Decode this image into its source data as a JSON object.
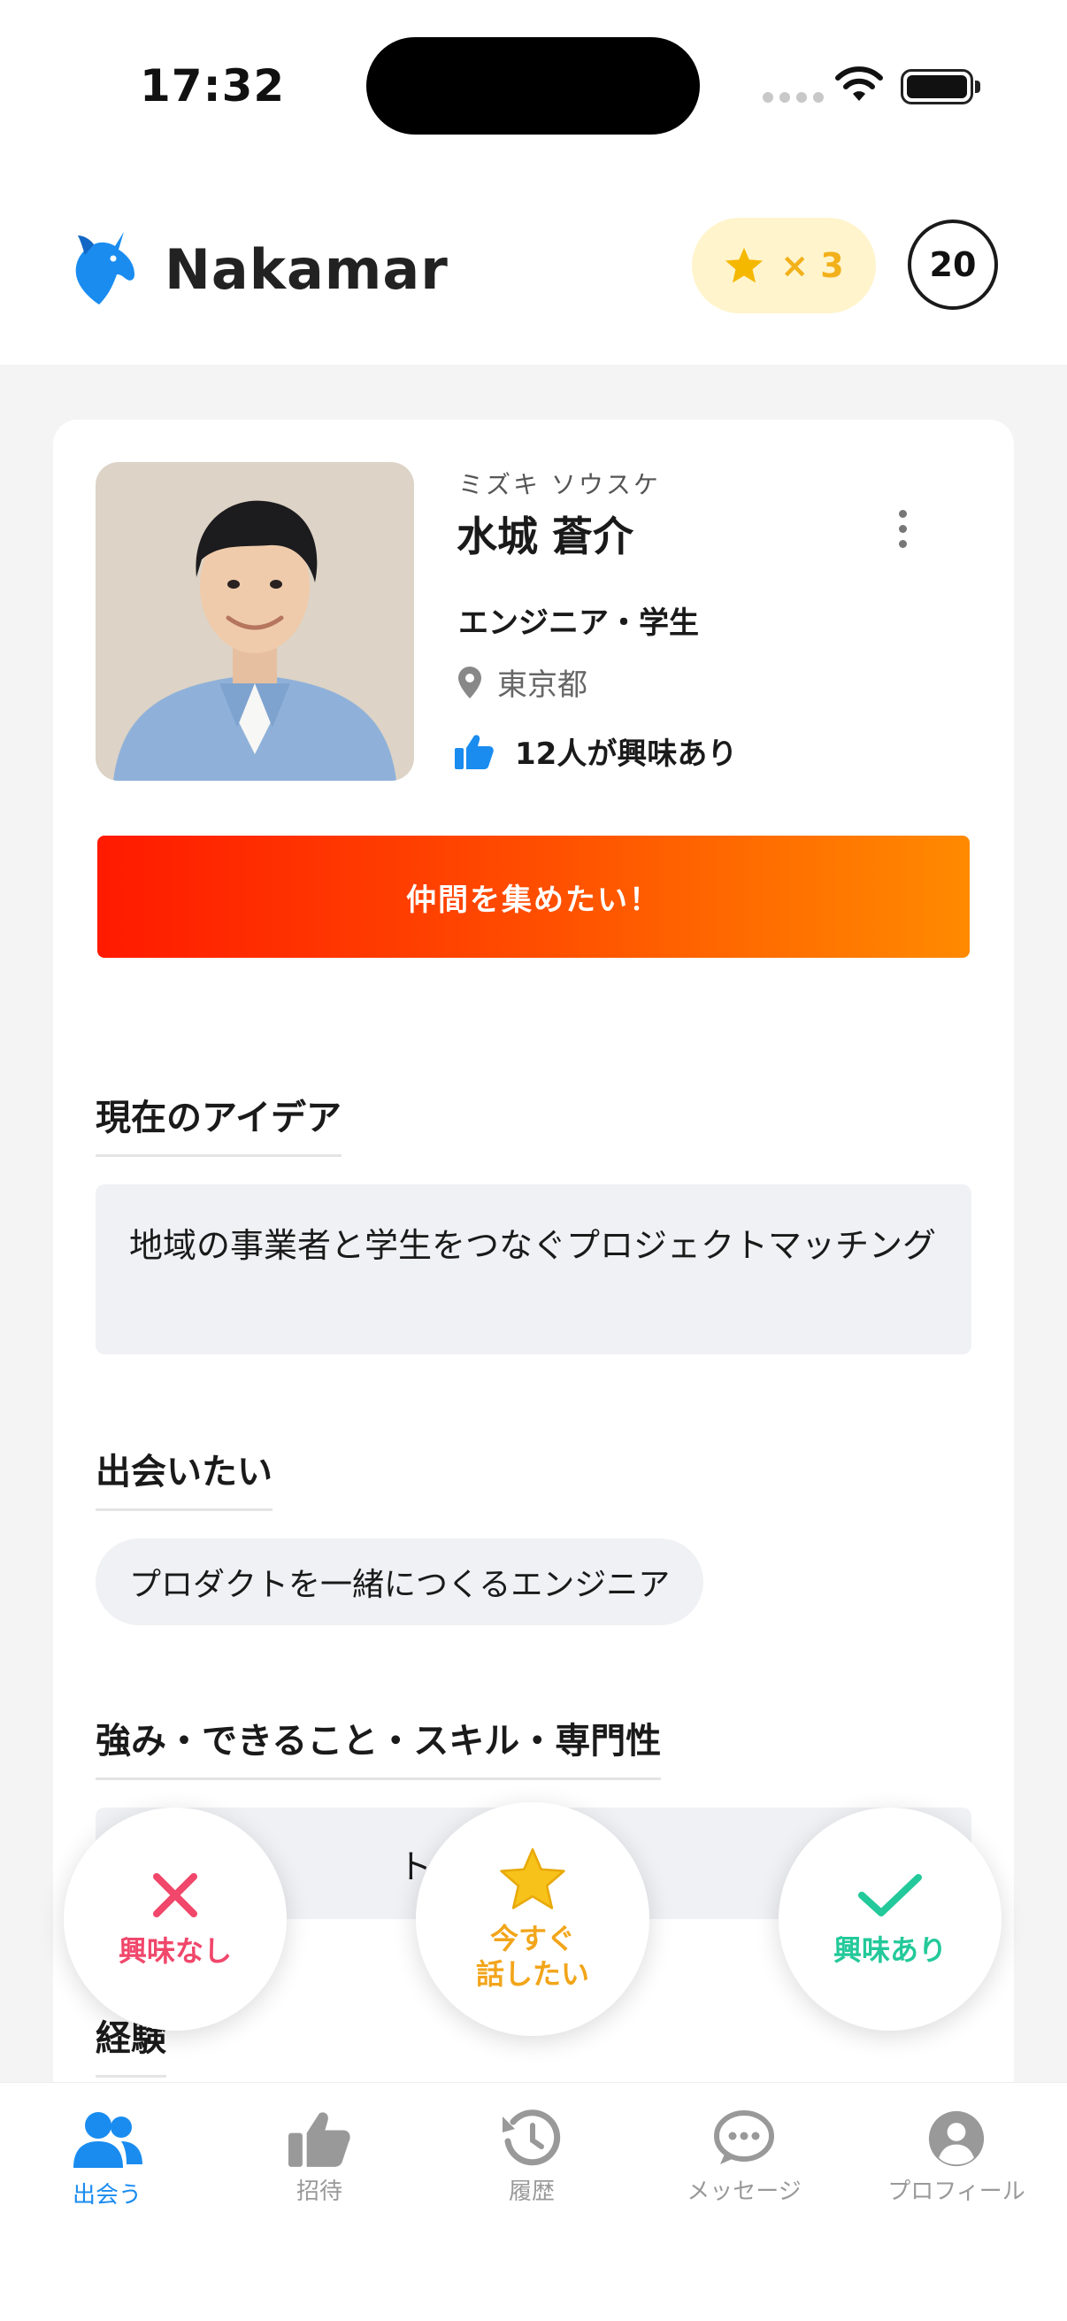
{
  "status_bar": {
    "time": "17:32"
  },
  "header": {
    "app_title": "Nakamar",
    "star_count": "× 3",
    "count_badge": "20"
  },
  "profile": {
    "kana": "ミズキ ソウスケ",
    "name": "水城 蒼介",
    "occupation": "エンジニア・学生",
    "location": "東京都",
    "interest": "12人が興味あり",
    "cta": "仲間を集めたい！"
  },
  "sections": {
    "idea_title": "現在のアイデア",
    "idea_text": "地域の事業者と学生をつなぐプロジェクトマッチング",
    "meet_title": "出会いたい",
    "meet_chip": "プロダクトを一緒につくるエンジニア",
    "skills_title": "強み・できること・スキル・専門性",
    "skills_text": "アプリ　　　　　トタイプ制",
    "experience_title": "経験"
  },
  "actions": {
    "no_label": "興味なし",
    "now_line1": "今すぐ",
    "now_line2": "話したい",
    "yes_label": "興味あり"
  },
  "tabs": [
    {
      "label": "出会う",
      "icon": "people-icon",
      "active": true
    },
    {
      "label": "招待",
      "icon": "thumbs-up-icon",
      "active": false
    },
    {
      "label": "履歴",
      "icon": "history-icon",
      "active": false
    },
    {
      "label": "メッセージ",
      "icon": "message-icon",
      "active": false
    },
    {
      "label": "プロフィール",
      "icon": "profile-icon",
      "active": false
    }
  ],
  "colors": {
    "accent_blue": "#1a8cf0",
    "cta_start": "#ff1a00",
    "cta_end": "#ff8a00",
    "no_red": "#f0476b",
    "now_yellow": "#f2a51a",
    "yes_green": "#23c99a"
  }
}
